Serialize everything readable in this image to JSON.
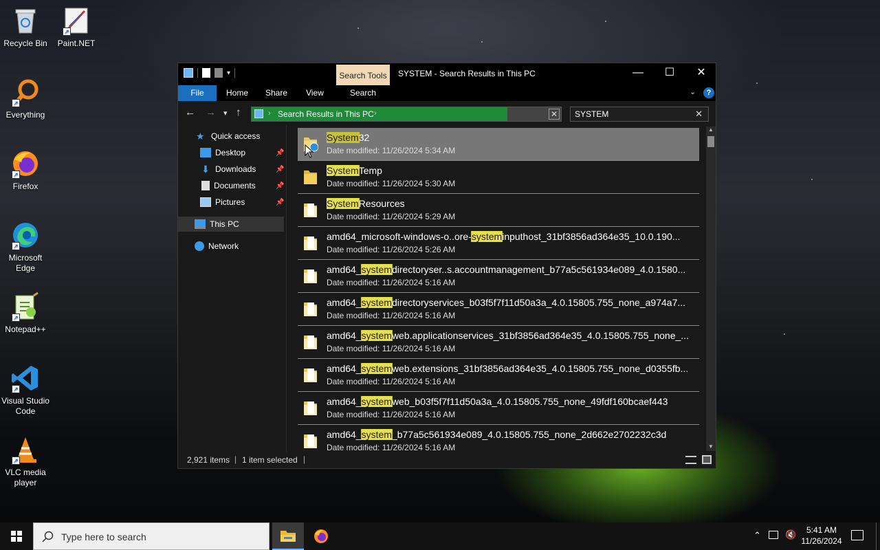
{
  "desktop": {
    "icons": [
      {
        "label": "Recycle Bin"
      },
      {
        "label": "Paint.NET"
      },
      {
        "label": "Everything"
      },
      {
        "label": "Firefox"
      },
      {
        "label": "Microsoft Edge"
      },
      {
        "label": "Notepad++"
      },
      {
        "label": "Visual Studio Code"
      },
      {
        "label": "VLC media player"
      }
    ]
  },
  "window": {
    "context_tab": "Search Tools",
    "title": "SYSTEM - Search Results in This PC",
    "ribbon_tabs": [
      "File",
      "Home",
      "Share",
      "View",
      "Search"
    ],
    "address": "Search Results in This PC",
    "search_value": "SYSTEM",
    "nav": {
      "quick_access": "Quick access",
      "desktop": "Desktop",
      "downloads": "Downloads",
      "documents": "Documents",
      "pictures": "Pictures",
      "this_pc": "This PC",
      "network": "Network"
    },
    "results": [
      {
        "pre": "",
        "hl": "System",
        "post": "32",
        "date": "Date modified: 11/26/2024 5:34 AM"
      },
      {
        "pre": "",
        "hl": "System",
        "post": "Temp",
        "date": "Date modified: 11/26/2024 5:30 AM"
      },
      {
        "pre": "",
        "hl": "System",
        "post": "Resources",
        "date": "Date modified: 11/26/2024 5:29 AM"
      },
      {
        "pre": "amd64_microsoft-windows-o..ore-",
        "hl": "system",
        "post": "inputhost_31bf3856ad364e35_10.0.190...",
        "date": "Date modified: 11/26/2024 5:26 AM"
      },
      {
        "pre": "amd64_",
        "hl": "system",
        "post": "directoryser..s.accountmanagement_b77a5c561934e089_4.0.1580...",
        "date": "Date modified: 11/26/2024 5:16 AM"
      },
      {
        "pre": "amd64_",
        "hl": "system",
        "post": "directoryservices_b03f5f7f11d50a3a_4.0.15805.755_none_a974a7...",
        "date": "Date modified: 11/26/2024 5:16 AM"
      },
      {
        "pre": "amd64_",
        "hl": "system",
        "post": "web.applicationservices_31bf3856ad364e35_4.0.15805.755_none_...",
        "date": "Date modified: 11/26/2024 5:16 AM"
      },
      {
        "pre": "amd64_",
        "hl": "system",
        "post": "web.extensions_31bf3856ad364e35_4.0.15805.755_none_d0355fb...",
        "date": "Date modified: 11/26/2024 5:16 AM"
      },
      {
        "pre": "amd64_",
        "hl": "system",
        "post": "web_b03f5f7f11d50a3a_4.0.15805.755_none_49fdf160bcaef443",
        "date": "Date modified: 11/26/2024 5:16 AM"
      },
      {
        "pre": "amd64_",
        "hl": "system",
        "post": "_b77a5c561934e089_4.0.15805.755_none_2d662e2702232c3d",
        "date": "Date modified: 11/26/2024 5:16 AM"
      }
    ],
    "status": {
      "count": "2,921 items",
      "selected": "1 item selected"
    }
  },
  "taskbar": {
    "search_placeholder": "Type here to search",
    "time": "5:41 AM",
    "date": "11/26/2024"
  }
}
